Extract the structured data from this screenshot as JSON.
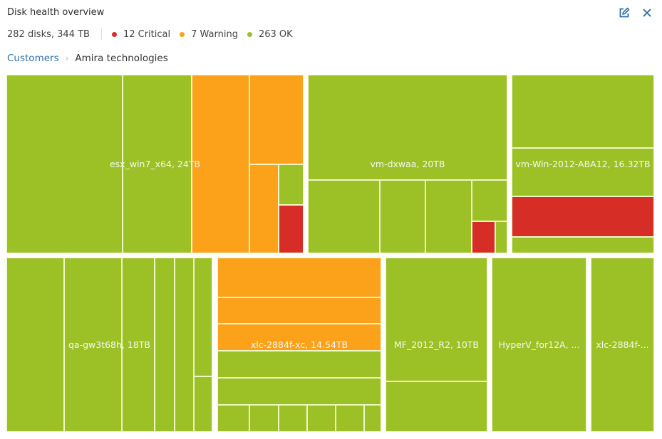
{
  "header": {
    "title": "Disk health overview",
    "edit_icon": "edit-icon",
    "close_icon": "close-icon"
  },
  "summary": {
    "totals": "282 disks, 344 TB",
    "stats": [
      {
        "label": "12 Critical",
        "color": "#d62e27"
      },
      {
        "label": "7 Warning",
        "color": "#fba11a"
      },
      {
        "label": "263 OK",
        "color": "#9bc126"
      }
    ]
  },
  "breadcrumb": {
    "items": [
      "Customers",
      "Amira technologies"
    ],
    "separator_icon": "chevron-right-icon"
  },
  "chart_data": {
    "type": "treemap",
    "title": "Disk health overview",
    "status_colors": {
      "ok": "#9bc126",
      "warning": "#fba11a",
      "critical": "#d62e27"
    },
    "groups": [
      {
        "name": "esx_win7_x64",
        "size_tb": 24,
        "label": "esx_win7_x64, 24TB",
        "disks": [
          {
            "status": "ok",
            "weight": 0.4
          },
          {
            "status": "ok",
            "weight": 0.24
          },
          {
            "status": "warning",
            "weight": 0.2
          },
          {
            "status": "warning",
            "weight": 0.11
          },
          {
            "status": "warning",
            "weight": 0.04
          },
          {
            "status": "ok",
            "weight": 0.019
          },
          {
            "status": "critical",
            "weight": 0.021
          }
        ]
      },
      {
        "name": "vm-dxwaa",
        "size_tb": 20,
        "label": "vm-dxwaa, 20TB",
        "disks": [
          {
            "status": "ok",
            "weight": 0.59
          },
          {
            "status": "ok",
            "weight": 0.14
          },
          {
            "status": "ok",
            "weight": 0.09
          },
          {
            "status": "ok",
            "weight": 0.09
          },
          {
            "status": "ok",
            "weight": 0.04
          },
          {
            "status": "critical",
            "weight": 0.03
          },
          {
            "status": "ok",
            "weight": 0.01
          }
        ]
      },
      {
        "name": "vm-Win-2012-ABA12",
        "size_tb": 16.32,
        "label": "vm-Win-2012-ABA12, 16.32TB",
        "disks": [
          {
            "status": "ok",
            "weight": 0.41
          },
          {
            "status": "ok",
            "weight": 0.26
          },
          {
            "status": "critical",
            "weight": 0.23
          },
          {
            "status": "ok",
            "weight": 0.1
          }
        ]
      },
      {
        "name": "qa-gw3t68h",
        "size_tb": 18,
        "label": "qa-gw3t68h, 18TB",
        "disks": [
          {
            "status": "ok",
            "weight": 0.28
          },
          {
            "status": "ok",
            "weight": 0.28
          },
          {
            "status": "ok",
            "weight": 0.16
          },
          {
            "status": "ok",
            "weight": 0.09
          },
          {
            "status": "ok",
            "weight": 0.09
          },
          {
            "status": "ok",
            "weight": 0.07
          },
          {
            "status": "ok",
            "weight": 0.03
          }
        ]
      },
      {
        "name": "xlc-2884f-xc",
        "size_tb": 14.54,
        "label": "xlc-2884f-xc, 14.54TB",
        "disks": [
          {
            "status": "warning",
            "weight": 0.23
          },
          {
            "status": "warning",
            "weight": 0.15
          },
          {
            "status": "warning",
            "weight": 0.15
          },
          {
            "status": "ok",
            "weight": 0.15
          },
          {
            "status": "ok",
            "weight": 0.15
          },
          {
            "status": "ok",
            "weight": 0.035
          },
          {
            "status": "ok",
            "weight": 0.031
          },
          {
            "status": "ok",
            "weight": 0.031
          },
          {
            "status": "ok",
            "weight": 0.031
          },
          {
            "status": "ok",
            "weight": 0.031
          },
          {
            "status": "ok",
            "weight": 0.021
          }
        ]
      },
      {
        "name": "MF_2012_R2",
        "size_tb": 10,
        "label": "MF_2012_R2, 10TB",
        "disks": [
          {
            "status": "ok",
            "weight": 0.71
          },
          {
            "status": "ok",
            "weight": 0.29
          }
        ]
      },
      {
        "name": "HyperV_for12A",
        "label": "HyperV_for12A, ...",
        "disks": [
          {
            "status": "ok",
            "weight": 1
          }
        ]
      },
      {
        "name": "xlc-2884f-",
        "label": "xlc-2884f-...",
        "disks": [
          {
            "status": "ok",
            "weight": 1
          }
        ]
      }
    ]
  }
}
